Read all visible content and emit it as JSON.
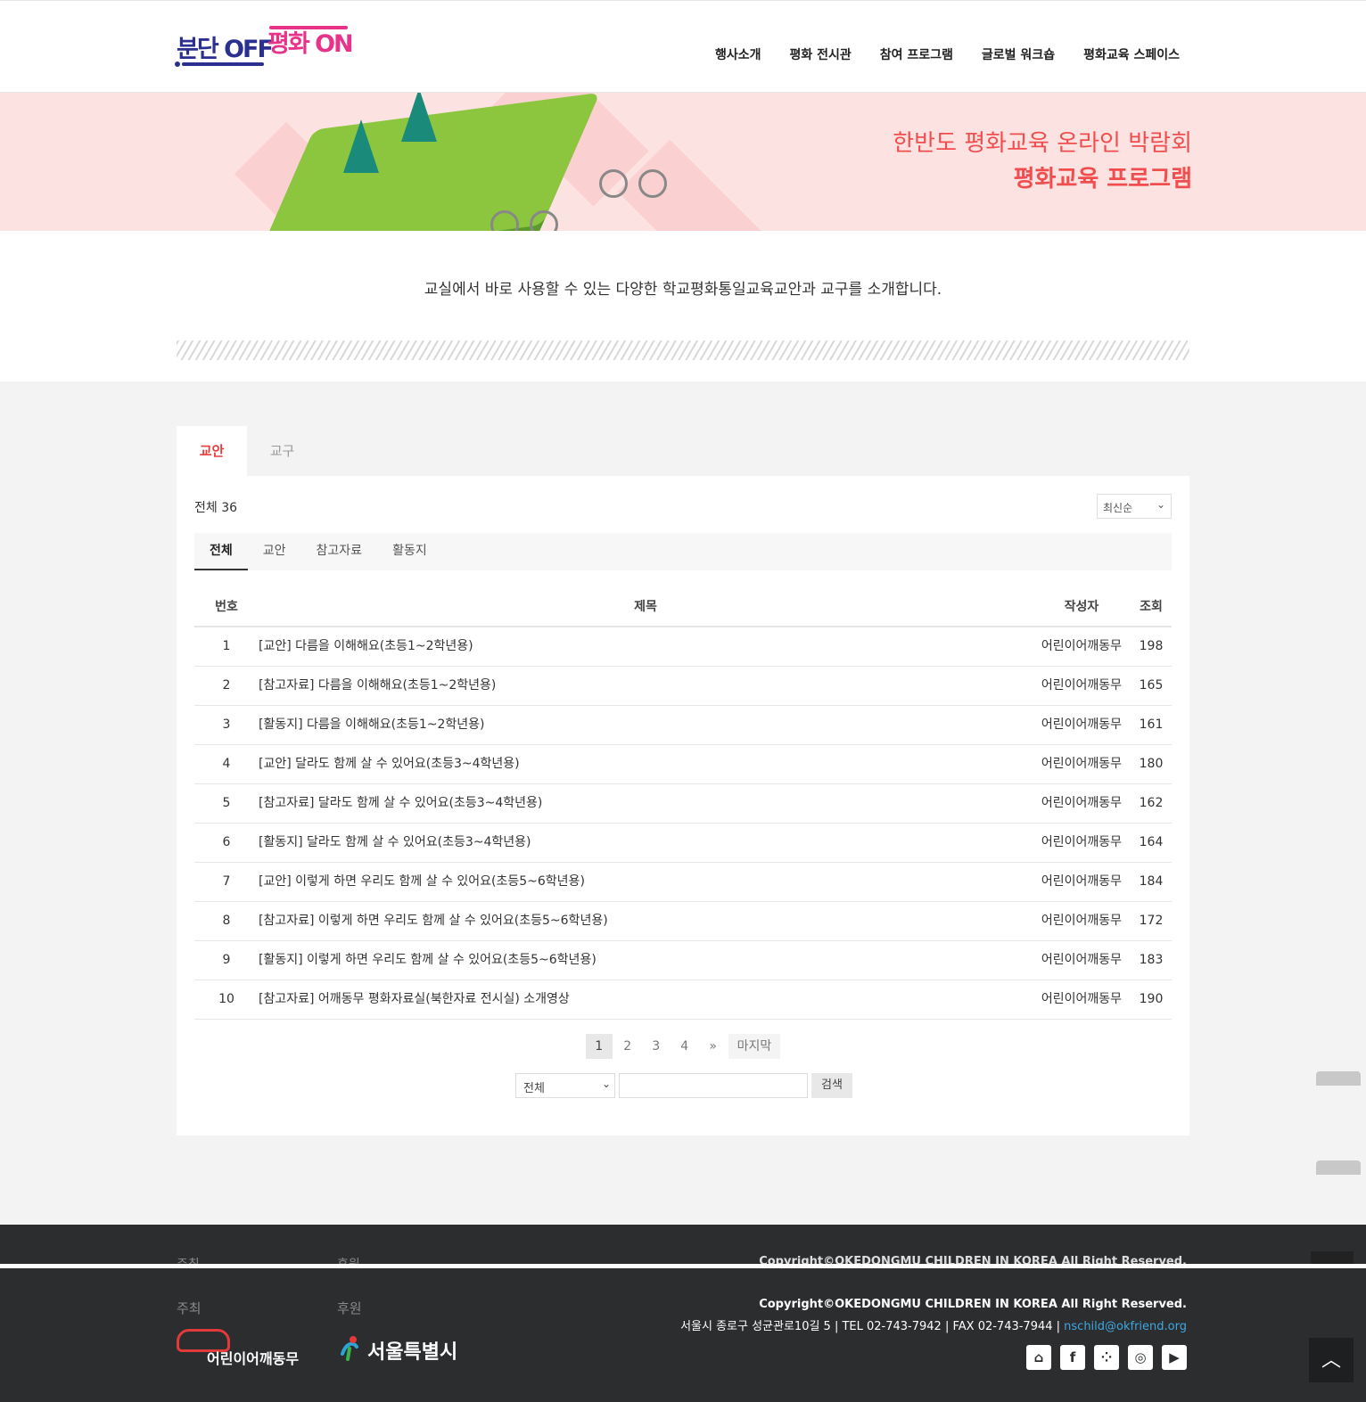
{
  "header": {
    "logo_text_1": "분단 OFF",
    "logo_text_2": "평화 ON",
    "nav": [
      "행사소개",
      "평화 전시관",
      "참여 프로그램",
      "글로벌 워크숍",
      "평화교육 스페이스"
    ]
  },
  "banner": {
    "title": "한반도 평화교육 온라인 박람회",
    "subtitle": "평화교육 프로그램"
  },
  "intro": "교실에서 바로 사용할 수 있는 다양한 학교평화통일교육교안과 교구를 소개합니다.",
  "tabs": [
    "교안",
    "교구"
  ],
  "board": {
    "total_label": "전체 36",
    "sort_value": "최신순",
    "categories": [
      "전체",
      "교안",
      "참고자료",
      "활동지"
    ],
    "columns": [
      "번호",
      "제목",
      "작성자",
      "조회"
    ],
    "rows": [
      {
        "no": "1",
        "title": "[교안] 다름을 이해해요(초등1~2학년용)",
        "writer": "어린이어깨동무",
        "hits": "198"
      },
      {
        "no": "2",
        "title": "[참고자료] 다름을 이해해요(초등1~2학년용)",
        "writer": "어린이어깨동무",
        "hits": "165"
      },
      {
        "no": "3",
        "title": "[활동지] 다름을 이해해요(초등1~2학년용)",
        "writer": "어린이어깨동무",
        "hits": "161"
      },
      {
        "no": "4",
        "title": "[교안] 달라도 함께 살 수 있어요(초등3~4학년용)",
        "writer": "어린이어깨동무",
        "hits": "180"
      },
      {
        "no": "5",
        "title": "[참고자료] 달라도 함께 살 수 있어요(초등3~4학년용)",
        "writer": "어린이어깨동무",
        "hits": "162"
      },
      {
        "no": "6",
        "title": "[활동지] 달라도 함께 살 수 있어요(초등3~4학년용)",
        "writer": "어린이어깨동무",
        "hits": "164"
      },
      {
        "no": "7",
        "title": "[교안] 이렇게 하면 우리도 함께 살 수 있어요(초등5~6학년용)",
        "writer": "어린이어깨동무",
        "hits": "184"
      },
      {
        "no": "8",
        "title": "[참고자료] 이렇게 하면 우리도 함께 살 수 있어요(초등5~6학년용)",
        "writer": "어린이어깨동무",
        "hits": "172"
      },
      {
        "no": "9",
        "title": "[활동지] 이렇게 하면 우리도 함께 살 수 있어요(초등5~6학년용)",
        "writer": "어린이어깨동무",
        "hits": "183"
      },
      {
        "no": "10",
        "title": "[참고자료] 어깨동무 평화자료실(북한자료 전시실) 소개영상",
        "writer": "어린이어깨동무",
        "hits": "190"
      }
    ],
    "pagination": [
      "1",
      "2",
      "3",
      "4",
      "»",
      "마지막"
    ],
    "search_select": "전체",
    "search_button": "검색"
  },
  "footer": {
    "host_label": "주최",
    "sponsor_label": "후원",
    "host_org": "어린이어깨동무",
    "sponsor_org": "서울특별시",
    "copyright": "Copyright©OKEDONGMU CHILDREN IN KOREA All Right Reserved.",
    "address": "서울시 종로구 성균관로10길 5 | TEL 02-743-7942 | FAX 02-743-7944 | ",
    "email": "nschild@okfriend.org",
    "sns_icons": [
      "home-icon",
      "facebook-icon",
      "kakao-icon",
      "instagram-icon",
      "youtube-icon"
    ]
  },
  "colors": {
    "accent_red": "#e73d3d",
    "brand_navy": "#2b2f8f",
    "brand_pink": "#e8338a",
    "banner_bg": "#fde2e2",
    "footer_bg": "#2b2d2f",
    "link_blue": "#3fa7e0"
  }
}
